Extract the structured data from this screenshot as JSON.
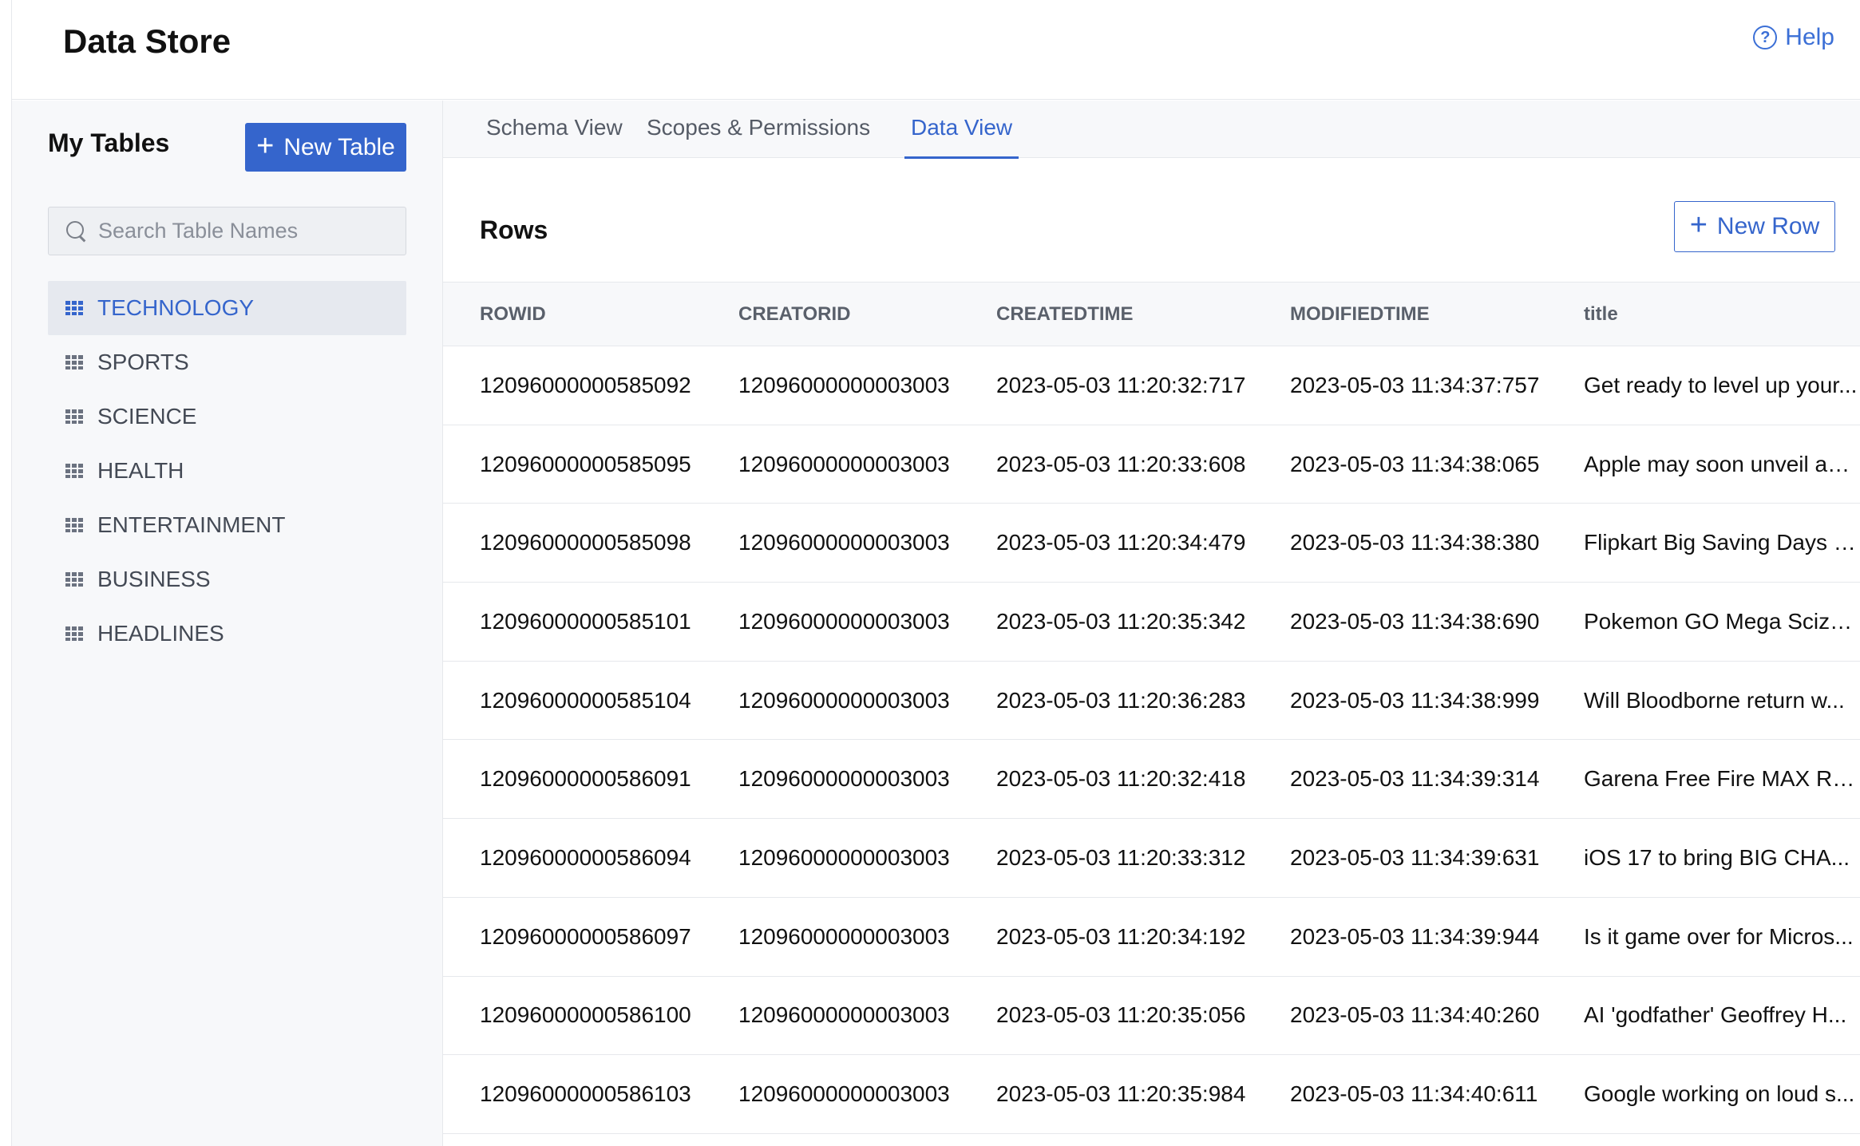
{
  "app": {
    "title": "Data Store",
    "help_label": "Help"
  },
  "sidebar": {
    "title": "My Tables",
    "new_table_label": "New Table",
    "search_placeholder": "Search Table Names",
    "items": [
      {
        "label": "TECHNOLOGY",
        "active": true
      },
      {
        "label": "SPORTS"
      },
      {
        "label": "SCIENCE"
      },
      {
        "label": "HEALTH"
      },
      {
        "label": "ENTERTAINMENT"
      },
      {
        "label": "BUSINESS"
      },
      {
        "label": "HEADLINES"
      }
    ]
  },
  "tabs": [
    {
      "label": "Schema View"
    },
    {
      "label": "Scopes & Permissions"
    },
    {
      "label": "Data View",
      "active": true
    }
  ],
  "main": {
    "rows_title": "Rows",
    "new_row_label": "New Row",
    "columns": [
      "ROWID",
      "CREATORID",
      "CREATEDTIME",
      "MODIFIEDTIME",
      "title"
    ],
    "rows": [
      [
        "12096000000585092",
        "12096000000003003",
        "2023-05-03 11:20:32:717",
        "2023-05-03 11:34:37:757",
        "Get ready to level up your..."
      ],
      [
        "12096000000585095",
        "12096000000003003",
        "2023-05-03 11:20:33:608",
        "2023-05-03 11:34:38:065",
        "Apple may soon unveil an ..."
      ],
      [
        "12096000000585098",
        "12096000000003003",
        "2023-05-03 11:20:34:479",
        "2023-05-03 11:34:38:380",
        "Flipkart Big Saving Days S..."
      ],
      [
        "12096000000585101",
        "12096000000003003",
        "2023-05-03 11:20:35:342",
        "2023-05-03 11:34:38:690",
        "Pokemon GO Mega Scizo..."
      ],
      [
        "12096000000585104",
        "12096000000003003",
        "2023-05-03 11:20:36:283",
        "2023-05-03 11:34:38:999",
        "Will Bloodborne return w..."
      ],
      [
        "12096000000586091",
        "12096000000003003",
        "2023-05-03 11:20:32:418",
        "2023-05-03 11:34:39:314",
        "Garena Free Fire MAX Re..."
      ],
      [
        "12096000000586094",
        "12096000000003003",
        "2023-05-03 11:20:33:312",
        "2023-05-03 11:34:39:631",
        "iOS 17 to bring BIG CHA..."
      ],
      [
        "12096000000586097",
        "12096000000003003",
        "2023-05-03 11:20:34:192",
        "2023-05-03 11:34:39:944",
        "Is it game over for Micros..."
      ],
      [
        "12096000000586100",
        "12096000000003003",
        "2023-05-03 11:20:35:056",
        "2023-05-03 11:34:40:260",
        "AI 'godfather' Geoffrey H..."
      ],
      [
        "12096000000586103",
        "12096000000003003",
        "2023-05-03 11:20:35:984",
        "2023-05-03 11:34:40:611",
        "Google working on loud s..."
      ]
    ]
  },
  "colors": {
    "accent": "#3565cc",
    "sidebar_bg": "#f7f8fa",
    "border": "#e6e8ec"
  }
}
